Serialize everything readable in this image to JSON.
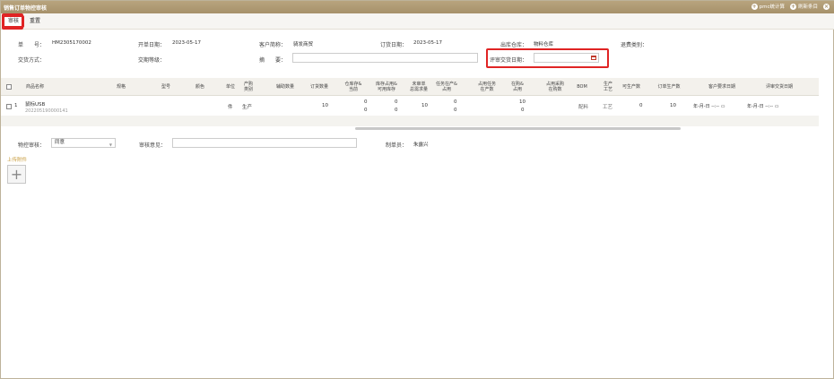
{
  "window": {
    "title": "销售订单物控审核",
    "right_buttons": [
      {
        "label": "pmc统计算",
        "icon": "plus-circle-icon"
      },
      {
        "label": "刷新条目",
        "icon": "plus-circle-icon"
      }
    ],
    "close_icon": "close-circle-icon"
  },
  "toolbar": {
    "buttons": [
      "审核",
      "重置"
    ],
    "active": "审核"
  },
  "form": {
    "doc_no_label": "单　　号：",
    "doc_no": "HM2305170002",
    "open_date_label": "开单日期：",
    "open_date": "2023-05-17",
    "customer_label": "客户简称：",
    "customer": "骑发商贸",
    "order_date_label": "订货日期：",
    "order_date": "2023-05-17",
    "warehouse_label": "出库仓库：",
    "warehouse": "物料仓库",
    "return_type_label": "退费类别：",
    "delivery_label": "交货方式：",
    "delivery_level_label": "交期等级：",
    "summary_label": "摘　　要：",
    "review_date_label": "评审交货日期："
  },
  "table": {
    "headers": [
      "商品名称",
      "规格",
      "型号",
      "颜色",
      "单位",
      "产购\n类别",
      "辅助数量",
      "订货数量",
      "仓库存&\n当前",
      "库存占用&\n可用库存",
      "未审单\n总需求量",
      "任务在产&\n占用",
      "占用任务\n在产数",
      "在购&\n占用",
      "占用采购\n在购数",
      "BOM",
      "生产\n工艺",
      "可生产数",
      "订单生产数",
      "客户要求日期",
      "评审交货日期"
    ],
    "rows": [
      {
        "index": "1",
        "name": "鼠标USB",
        "code": "202205190000141",
        "unit": "件",
        "category": "生产",
        "order_qty": "10",
        "stock_top": "0",
        "stock_bottom": "0",
        "occupy_top": "0",
        "occupy_bottom": "0",
        "unreviewed": "10",
        "task_top": "0",
        "task_bottom": "0",
        "buy_top": "10",
        "buy_bottom": "0",
        "bom": "配料",
        "process": "工艺",
        "producible": "0",
        "order_prod": "10",
        "cust_date": "年-月-日 --:-- ",
        "review_date": "年-月-日 --:-- "
      }
    ]
  },
  "footer": {
    "control_label": "物控审核：",
    "control_value": "同意",
    "opinion_label": "审核意见：",
    "maker_label": "制单员：",
    "maker": "朱露兴",
    "upload_label": "上传附件",
    "upload_icon": "plus-icon"
  },
  "colors": {
    "accent": "#a6916a",
    "highlight": "#e02424"
  }
}
